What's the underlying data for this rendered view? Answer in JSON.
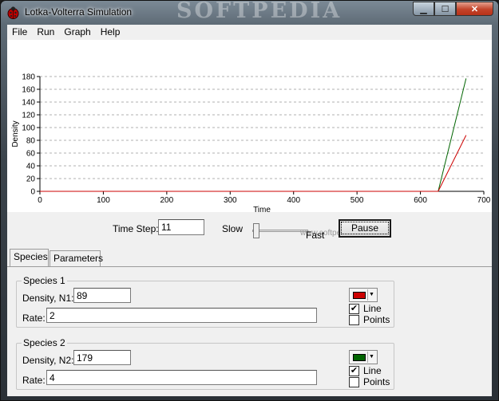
{
  "window": {
    "title": "Lotka-Volterra Simulation",
    "watermark": "SOFTPEDIA"
  },
  "caption_buttons": {
    "minimize": "▁",
    "maximize": "☐",
    "close": "✕"
  },
  "menu": {
    "items": [
      "File",
      "Run",
      "Graph",
      "Help"
    ]
  },
  "chart_data": {
    "type": "line",
    "xlabel": "Time",
    "ylabel": "Density",
    "xlim": [
      0,
      700
    ],
    "ylim": [
      0,
      180
    ],
    "x_ticks": [
      0,
      100,
      200,
      300,
      400,
      500,
      600,
      700
    ],
    "y_ticks": [
      0,
      20,
      40,
      60,
      80,
      100,
      120,
      140,
      160,
      180
    ],
    "grid": true,
    "series": [
      {
        "color": "#006400",
        "x": [
          0,
          628,
          672
        ],
        "y": [
          0,
          0,
          177
        ]
      },
      {
        "color": "#cc0000",
        "x": [
          0,
          628,
          672
        ],
        "y": [
          0,
          0,
          88
        ]
      }
    ]
  },
  "controls": {
    "time_step_label": "Time Step:",
    "time_step_value": "11",
    "slow_label": "Slow",
    "fast_label": "Fast",
    "pause_label": "Pause",
    "watermark_line": "www.softpedia.com"
  },
  "tabs": [
    {
      "label": "Species"
    },
    {
      "label": "Parameters"
    }
  ],
  "species": [
    {
      "title": "Species 1",
      "density_label": "Density, N1:",
      "density_value": "89",
      "rate_label": "Rate:",
      "rate_value": "2",
      "color": "#cc0000",
      "line_label": "Line",
      "line_checked": "✔",
      "points_label": "Points",
      "points_checked": ""
    },
    {
      "title": "Species 2",
      "density_label": "Density, N2:",
      "density_value": "179",
      "rate_label": "Rate:",
      "rate_value": "4",
      "color": "#006400",
      "line_label": "Line",
      "line_checked": "✔",
      "points_label": "Points",
      "points_checked": ""
    }
  ]
}
